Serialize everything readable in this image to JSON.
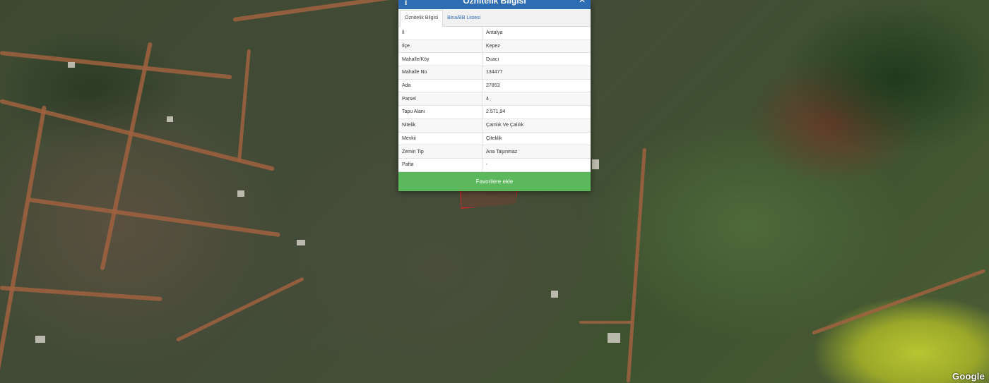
{
  "panel": {
    "title": "Öznitelik Bilgisi",
    "tabs": [
      {
        "label": "Öznitelik Bilgisi",
        "active": true
      },
      {
        "label": "Bina/BB Listesi",
        "active": false
      }
    ],
    "rows": [
      {
        "key": "İl",
        "value": "Antalya"
      },
      {
        "key": "İlçe",
        "value": "Kepez"
      },
      {
        "key": "Mahalle/Köy",
        "value": "Duacı"
      },
      {
        "key": "Mahalle No",
        "value": "134477"
      },
      {
        "key": "Ada",
        "value": "27853"
      },
      {
        "key": "Parsel",
        "value": "4"
      },
      {
        "key": "Tapu Alanı",
        "value": "2.571,94"
      },
      {
        "key": "Nitelik",
        "value": "Çamlık Ve Çalılık"
      },
      {
        "key": "Mevkii",
        "value": "Çiteklik"
      },
      {
        "key": "Zemin Tip",
        "value": "Ana Taşınmaz"
      },
      {
        "key": "Pafta",
        "value": "-"
      }
    ],
    "favorite_button": "Favorilere ekle"
  },
  "map": {
    "attribution": "Google"
  },
  "colors": {
    "header": "#2e6db4",
    "button": "#5cb85c",
    "parcel_outline": "#c62828"
  },
  "icons": {
    "header_left": "info-icon",
    "header_right": "close-icon"
  }
}
